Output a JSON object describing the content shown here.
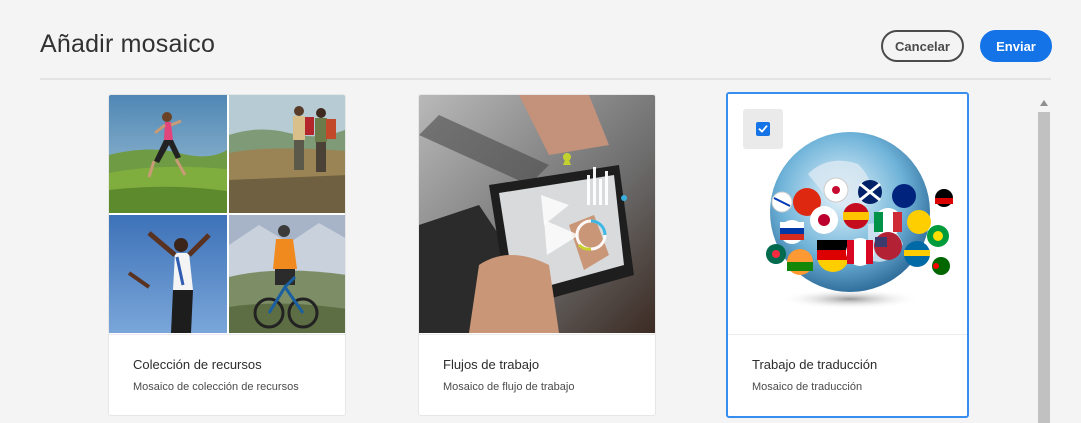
{
  "header": {
    "title": "Añadir mosaico",
    "cancel_label": "Cancelar",
    "submit_label": "Enviar"
  },
  "cards": [
    {
      "title": "Colección de recursos",
      "subtitle": "Mosaico de colección de recursos",
      "selected": false
    },
    {
      "title": "Flujos de trabajo",
      "subtitle": "Mosaico de flujo de trabajo",
      "selected": false
    },
    {
      "title": "Trabajo de traducción",
      "subtitle": "Mosaico de traducción",
      "selected": true
    }
  ],
  "colors": {
    "accent": "#1473e6",
    "selected_border": "#378ef0",
    "background": "#f4f4f4"
  }
}
